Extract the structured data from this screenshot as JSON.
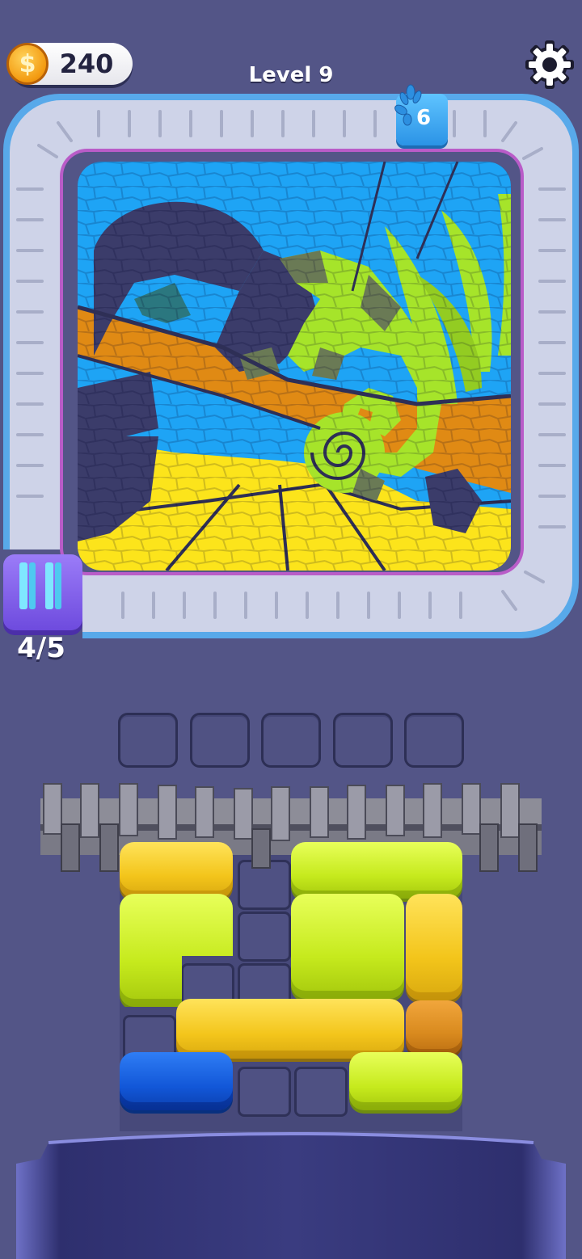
{
  "hud": {
    "coins": "240",
    "level_label": "Level 9",
    "icons": {
      "coin": "coin-icon",
      "settings": "gear-icon"
    }
  },
  "conveyor": {
    "remaining_count": "6",
    "counter_icon": "paint-splash-icon"
  },
  "shooter": {
    "progress": "4/5",
    "icon": "stripes-icon"
  },
  "mosaic": {
    "subject": "chameleon-on-branch",
    "palette": {
      "sky": "#1ea4f5",
      "sand": "#fce41b",
      "branch": "#e08a14",
      "chameleon": "#a6e42a",
      "leaves": "#a6e42a",
      "empty": "#3b3c6a"
    }
  },
  "slots": {
    "count": 5,
    "filled": 0
  },
  "blocks": [
    {
      "color": "yellow",
      "hex": "#f4cc22"
    },
    {
      "color": "lime",
      "hex": "#ccec22"
    },
    {
      "color": "lime",
      "hex": "#ccec22"
    },
    {
      "color": "lime",
      "hex": "#ccec22"
    },
    {
      "color": "yellow",
      "hex": "#f4cc22"
    },
    {
      "color": "yellow",
      "hex": "#f4cc22"
    },
    {
      "color": "orange",
      "hex": "#dd8d20"
    },
    {
      "color": "blue",
      "hex": "#1660e0"
    },
    {
      "color": "lime",
      "hex": "#ccec22"
    }
  ],
  "colors": {
    "background": "#535587",
    "track": "#ced3e8",
    "track_border": "#58a9ea"
  }
}
